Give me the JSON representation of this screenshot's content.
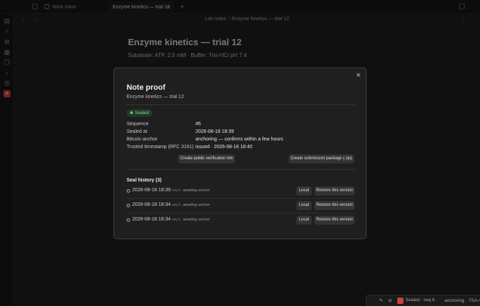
{
  "tabs": [
    {
      "label": "Work inbox",
      "active": false
    },
    {
      "label": "Enzyme kinetics — trial 12",
      "active": true
    }
  ],
  "breadcrumb": [
    "Lab notes",
    "Enzyme kinetics — trial 12"
  ],
  "note": {
    "title": "Enzyme kinetics — trial 12",
    "subtitle": "Substrate: ATP, 2.5 mM · Buffer: Tris-HCl pH 7.4"
  },
  "modal": {
    "title": "Note proof",
    "subtitle": "Enzyme kinetics — trial 12",
    "badge": "Sealed",
    "fields": [
      {
        "label": "Sequence",
        "value": "#6"
      },
      {
        "label": "Sealed at",
        "value": "2026-08-18 18:39"
      },
      {
        "label": "Bitcoin anchor",
        "value": "anchoring — confirms within a few hours"
      },
      {
        "label": "Trusted timestamp (RFC 3161)",
        "value": "issued · 2026-08-18 18:40"
      }
    ],
    "verify_button": "Create public verification link",
    "package_button": "Create submission package (.zip)",
    "history_title": "Seal history (3)",
    "history": [
      {
        "date": "2026-08-18 18:39",
        "seq": "seq 6",
        "status": "awaiting anchor",
        "local": "Local",
        "restore": "Restore this version"
      },
      {
        "date": "2026-08-18 18:34",
        "seq": "seq 5",
        "status": "awaiting anchor",
        "local": "Local",
        "restore": "Restore this version"
      },
      {
        "date": "2026-08-18 18:34",
        "seq": "seq 0",
        "status": "awaiting anchor",
        "local": "Local",
        "restore": "Restore this version"
      }
    ]
  },
  "statusbar": {
    "seal": "Sealed · seq 6 ·",
    "anchor": "anchoring · TSA✓"
  },
  "colors": {
    "accent_badge": "#5cc96e",
    "plugin_icon": "#c9443c",
    "background": "#1e1e1e"
  }
}
